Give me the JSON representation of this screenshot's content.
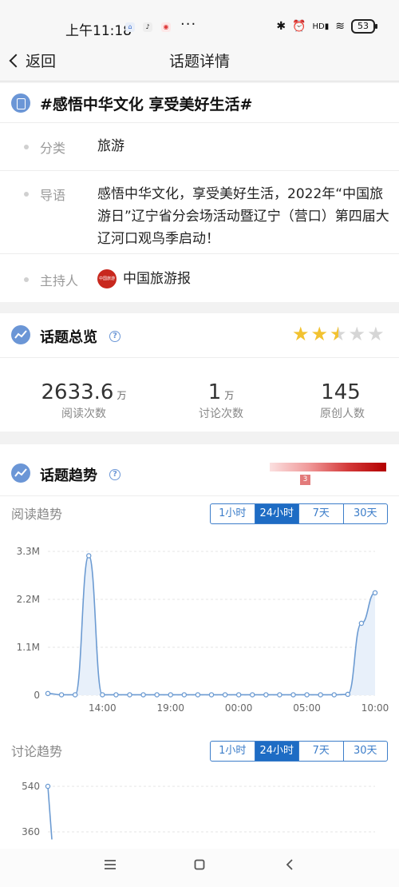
{
  "status": {
    "time": "上午11:18",
    "dots": "···",
    "signal": "HD",
    "battery": "53"
  },
  "nav": {
    "back_label": "返回",
    "title": "话题详情"
  },
  "topic": {
    "title": "#感悟中华文化 享受美好生活#",
    "category_label": "分类",
    "category_value": "旅游",
    "intro_label": "导语",
    "intro_value": "感悟中华文化，享受美好生活，2022年“中国旅游日”辽宁省分会场活动暨辽宁（营口）第四届大辽河口观鸟季启动！",
    "host_label": "主持人",
    "host_value": "中国旅游报",
    "host_logo_text": "中国旅游报"
  },
  "overview": {
    "title": "话题总览",
    "rating": 2.5,
    "stats": [
      {
        "value": "2633.6",
        "unit": "万",
        "label": "阅读次数"
      },
      {
        "value": "1",
        "unit": "万",
        "label": "讨论次数"
      },
      {
        "value": "145",
        "unit": "",
        "label": "原创人数"
      }
    ]
  },
  "trend": {
    "title": "话题趋势",
    "heat_level": "3",
    "read_title": "阅读趋势",
    "discuss_title": "讨论趋势",
    "range_tabs": [
      "1小时",
      "24小时",
      "7天",
      "30天"
    ],
    "active_tab": "24小时"
  },
  "chart_data": [
    {
      "type": "line",
      "title": "阅读趋势",
      "x_ticks": [
        "14:00",
        "19:00",
        "00:00",
        "05:00",
        "10:00"
      ],
      "y_ticks": [
        "0",
        "1.1M",
        "2.2M",
        "3.3M"
      ],
      "ylim": [
        0,
        3300000
      ],
      "x": [
        10,
        11,
        12,
        13,
        14,
        15,
        16,
        17,
        18,
        19,
        20,
        21,
        22,
        23,
        0,
        1,
        2,
        3,
        4,
        5,
        6,
        7,
        8,
        9,
        10
      ],
      "values": [
        40000,
        10000,
        10000,
        3200000,
        10000,
        10000,
        10000,
        10000,
        10000,
        10000,
        10000,
        10000,
        10000,
        10000,
        10000,
        10000,
        10000,
        10000,
        10000,
        10000,
        10000,
        10000,
        20000,
        1650000,
        2350000
      ]
    },
    {
      "type": "line",
      "title": "讨论趋势",
      "y_ticks": [
        "360",
        "540"
      ],
      "values": [
        540,
        330
      ]
    }
  ],
  "colors": {
    "accent": "#1e6cc4",
    "line": "#6c9bd2",
    "fill": "#e8f0fa",
    "star_on": "#f2c230",
    "star_off": "#d6d6d6"
  }
}
